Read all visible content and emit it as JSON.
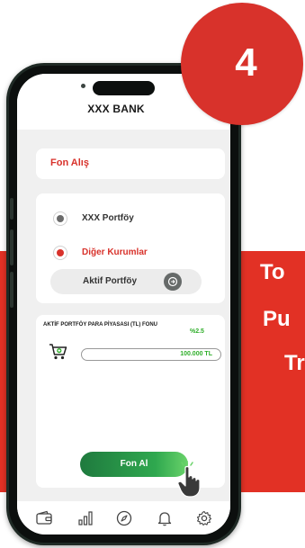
{
  "step_badge": {
    "number": "4"
  },
  "side_caption": {
    "line1": "To",
    "line2": "Pu",
    "line3": "Tr"
  },
  "header": {
    "title": "XXX BANK"
  },
  "fon_card": {
    "title": "Fon Alış"
  },
  "options": {
    "items": [
      {
        "label": "XXX Portföy",
        "selected": false
      },
      {
        "label": "Diğer Kurumlar",
        "selected": true
      }
    ],
    "provider_button": {
      "label": "Aktif Portföy",
      "icon": "arrow-circle-icon"
    }
  },
  "fund": {
    "name": "AKTİF PORTFÖY PARA PİYASASI (TL) FONU",
    "rate": "%2.5",
    "amount": "100.000 TL",
    "icon": "cart-icon"
  },
  "action": {
    "label": "Fon Al"
  },
  "bottom_nav": {
    "items": [
      "wallet-icon",
      "chart-icon",
      "compass-icon",
      "bell-icon",
      "settings-icon"
    ]
  },
  "colors": {
    "brand_red": "#d8322b",
    "band_red": "#e23125",
    "green": "#2fae2a",
    "phone_frame": "#1f2a25"
  }
}
